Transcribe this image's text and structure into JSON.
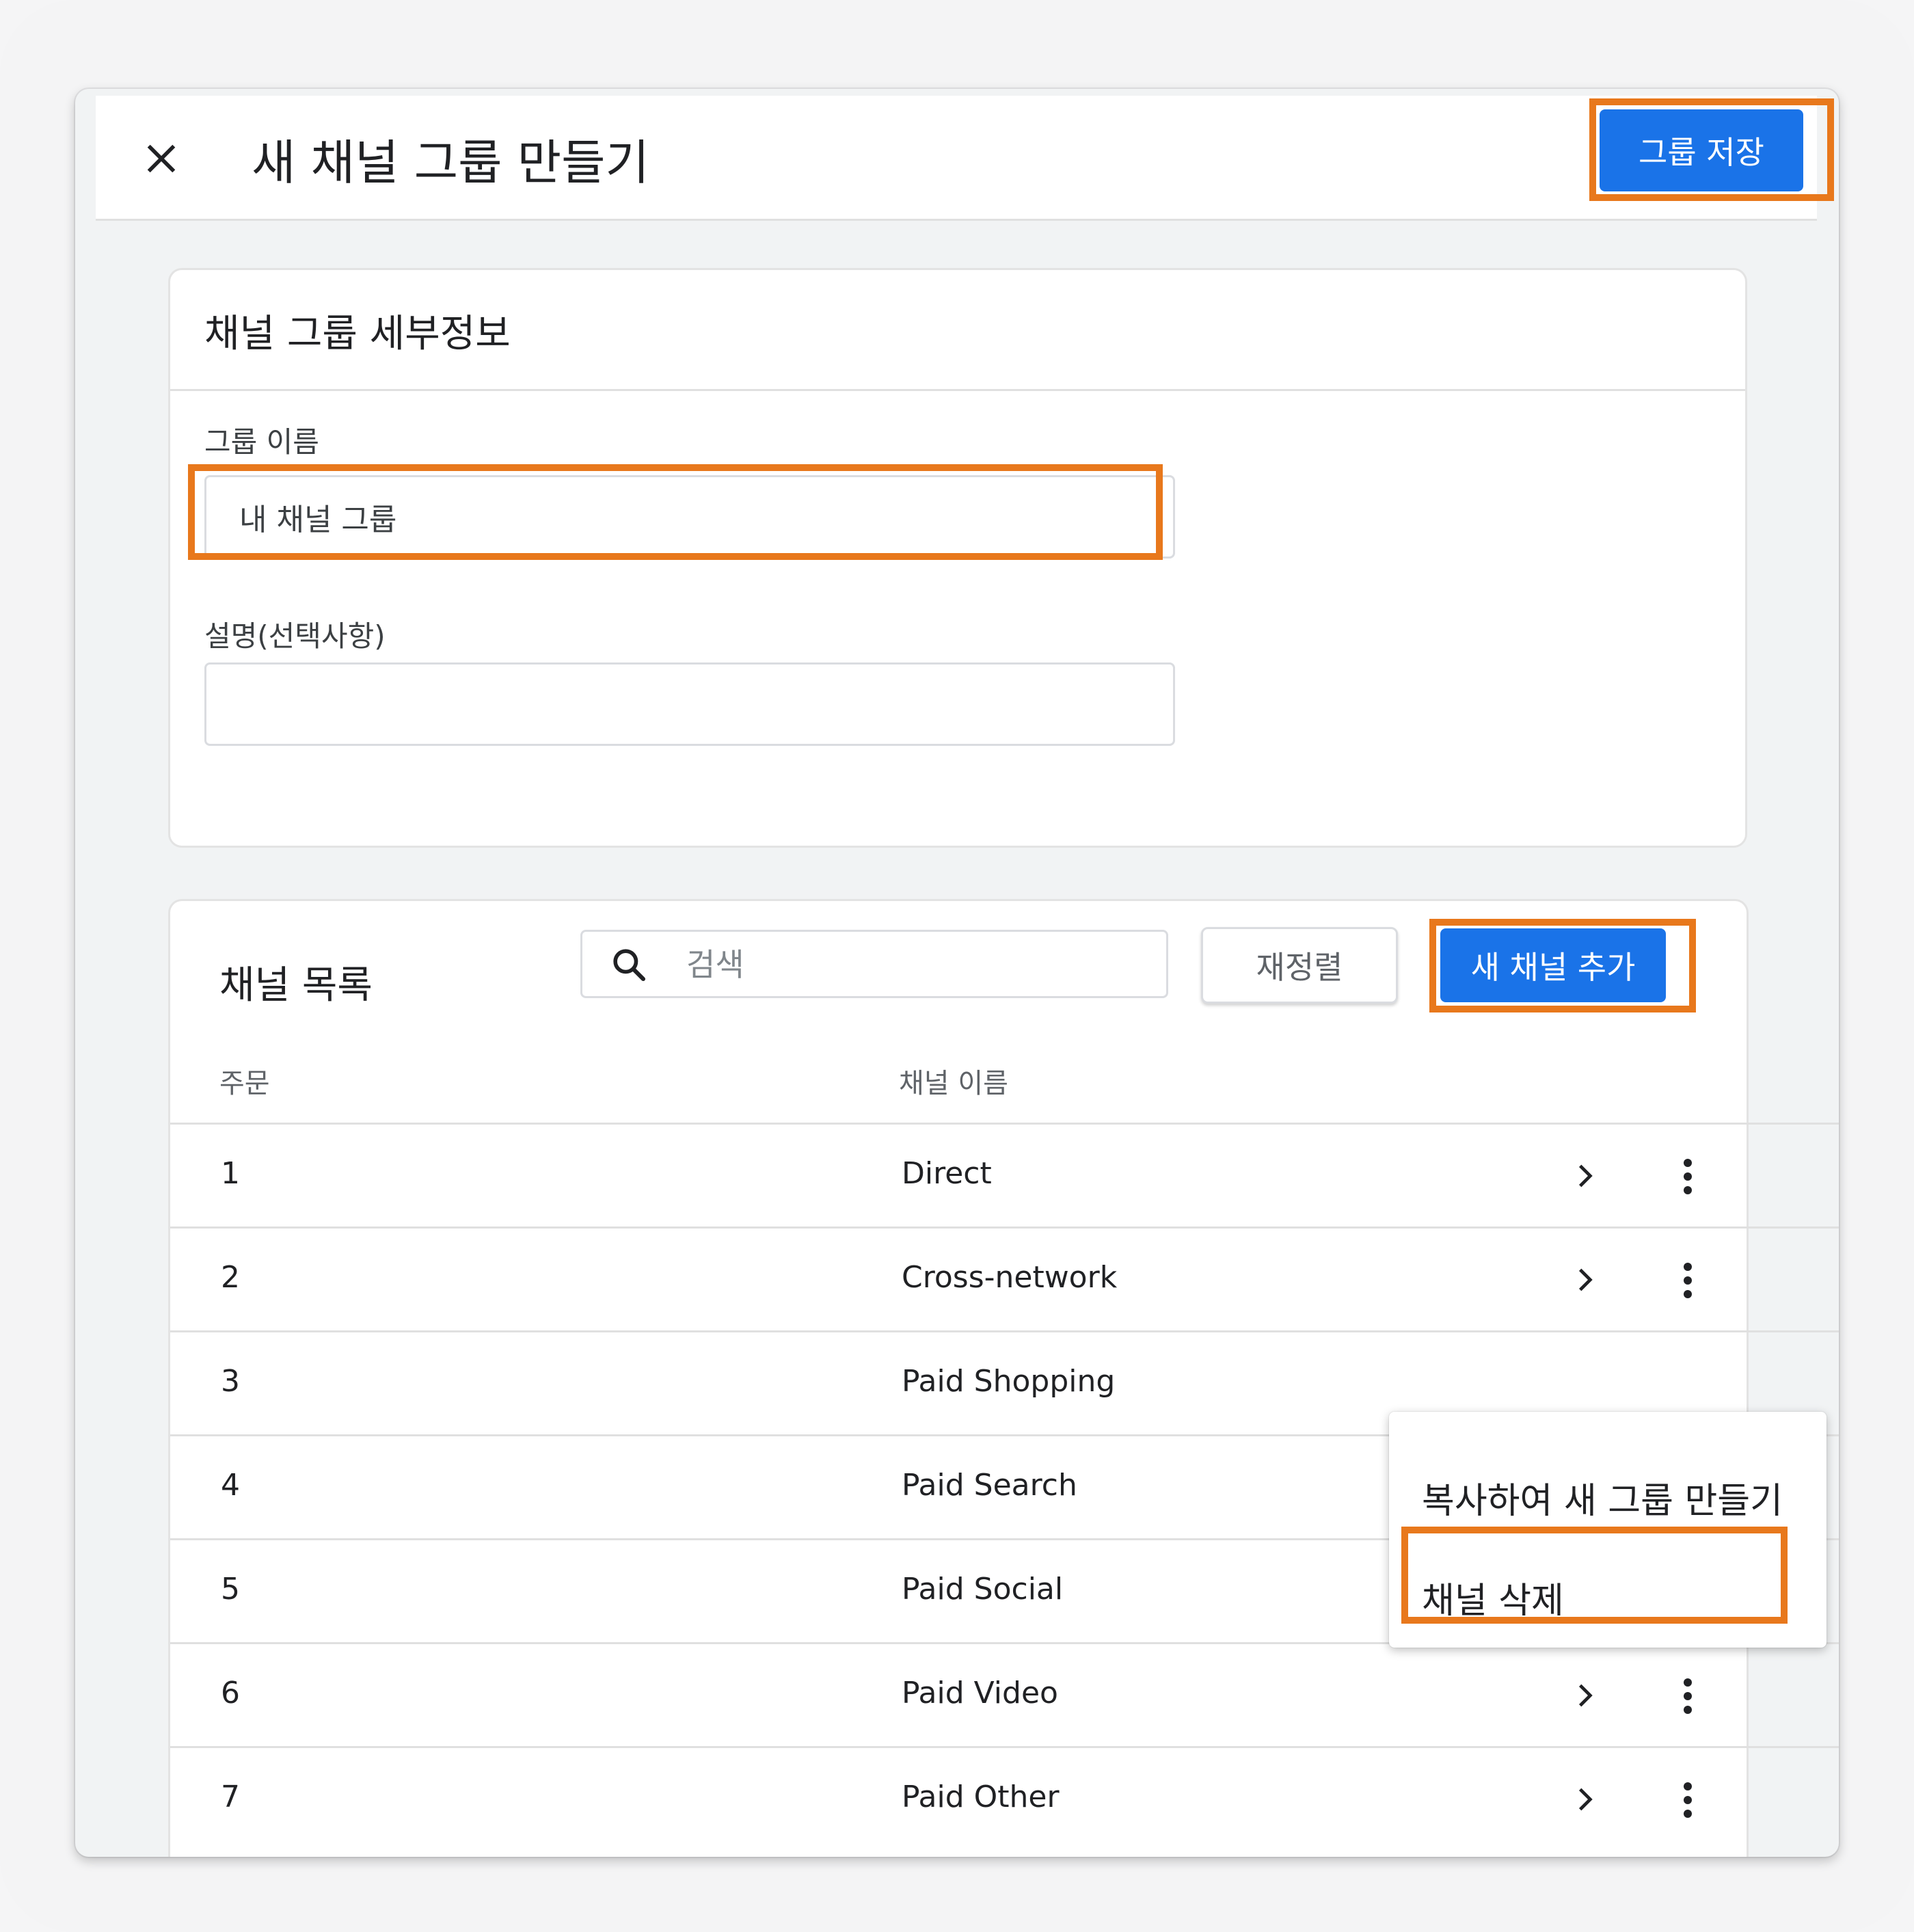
{
  "dialog": {
    "title": "새 채널 그룹 만들기",
    "save_label": "그룹 저장"
  },
  "details": {
    "title": "채널 그룹 세부정보",
    "name_label": "그룹 이름",
    "name_value": "내 채널 그룹",
    "desc_label": "설명(선택사항)",
    "desc_value": ""
  },
  "channels": {
    "title": "채널 목록",
    "search_placeholder": "검색",
    "reorder_label": "재정렬",
    "add_label": "새 채널 추가",
    "col_order": "주문",
    "col_name": "채널 이름",
    "rows": [
      {
        "order": "1",
        "name": "Direct"
      },
      {
        "order": "2",
        "name": "Cross-network"
      },
      {
        "order": "3",
        "name": "Paid Shopping"
      },
      {
        "order": "4",
        "name": "Paid Search"
      },
      {
        "order": "5",
        "name": "Paid Social"
      },
      {
        "order": "6",
        "name": "Paid Video"
      },
      {
        "order": "7",
        "name": "Paid Other"
      }
    ]
  },
  "context_menu": {
    "copy_label": "복사하여 새 그룹 만들기",
    "delete_label": "채널 삭제"
  },
  "colors": {
    "primary": "#1a73e8",
    "highlight": "#e8781c"
  }
}
